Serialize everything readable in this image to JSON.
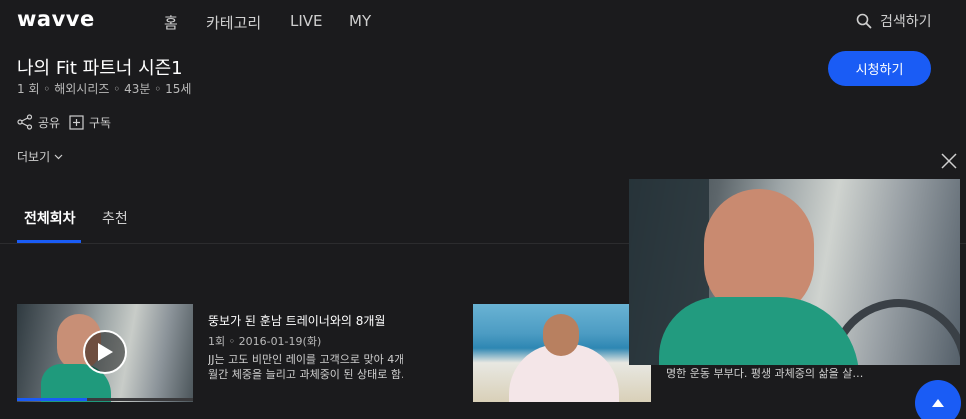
{
  "header": {
    "logo": "wavve",
    "nav": [
      "홈",
      "카테고리",
      "LIVE",
      "MY"
    ],
    "search_label": "검색하기"
  },
  "program": {
    "title": "나의 Fit 파트너 시즌1",
    "meta": "1 회 ◦ 해외시리즈 ◦ 43분 ◦ 15세",
    "watch_label": "시청하기",
    "share_label": "공유",
    "subscribe_label": "구독",
    "more_label": "더보기"
  },
  "tabs": [
    "전체회차",
    "추천"
  ],
  "episodes": [
    {
      "title": "뚱보가 된 훈남 트레이너와의 8개월",
      "meta": "1회 ◦ 2016-01-19(화)",
      "desc_line1": "JJ는 고도 비만인 레이를 고객으로 맞아 4개",
      "desc_line2": "월간 체중을 늘리고 과체중이 된 상태로 함…",
      "progress": 0.4
    },
    {
      "desc_partial": "명한 운동 부부다. 평생 과체중의 삶을 살…"
    }
  ],
  "icons": {
    "search": "search-icon",
    "share": "share-icon",
    "subscribe": "plus-square-icon",
    "more": "chevron-down-icon",
    "play": "play-icon",
    "close": "close-icon",
    "top": "arrow-up-icon"
  },
  "colors": {
    "accent": "#1a5cf5",
    "background": "#1b1b1d"
  }
}
